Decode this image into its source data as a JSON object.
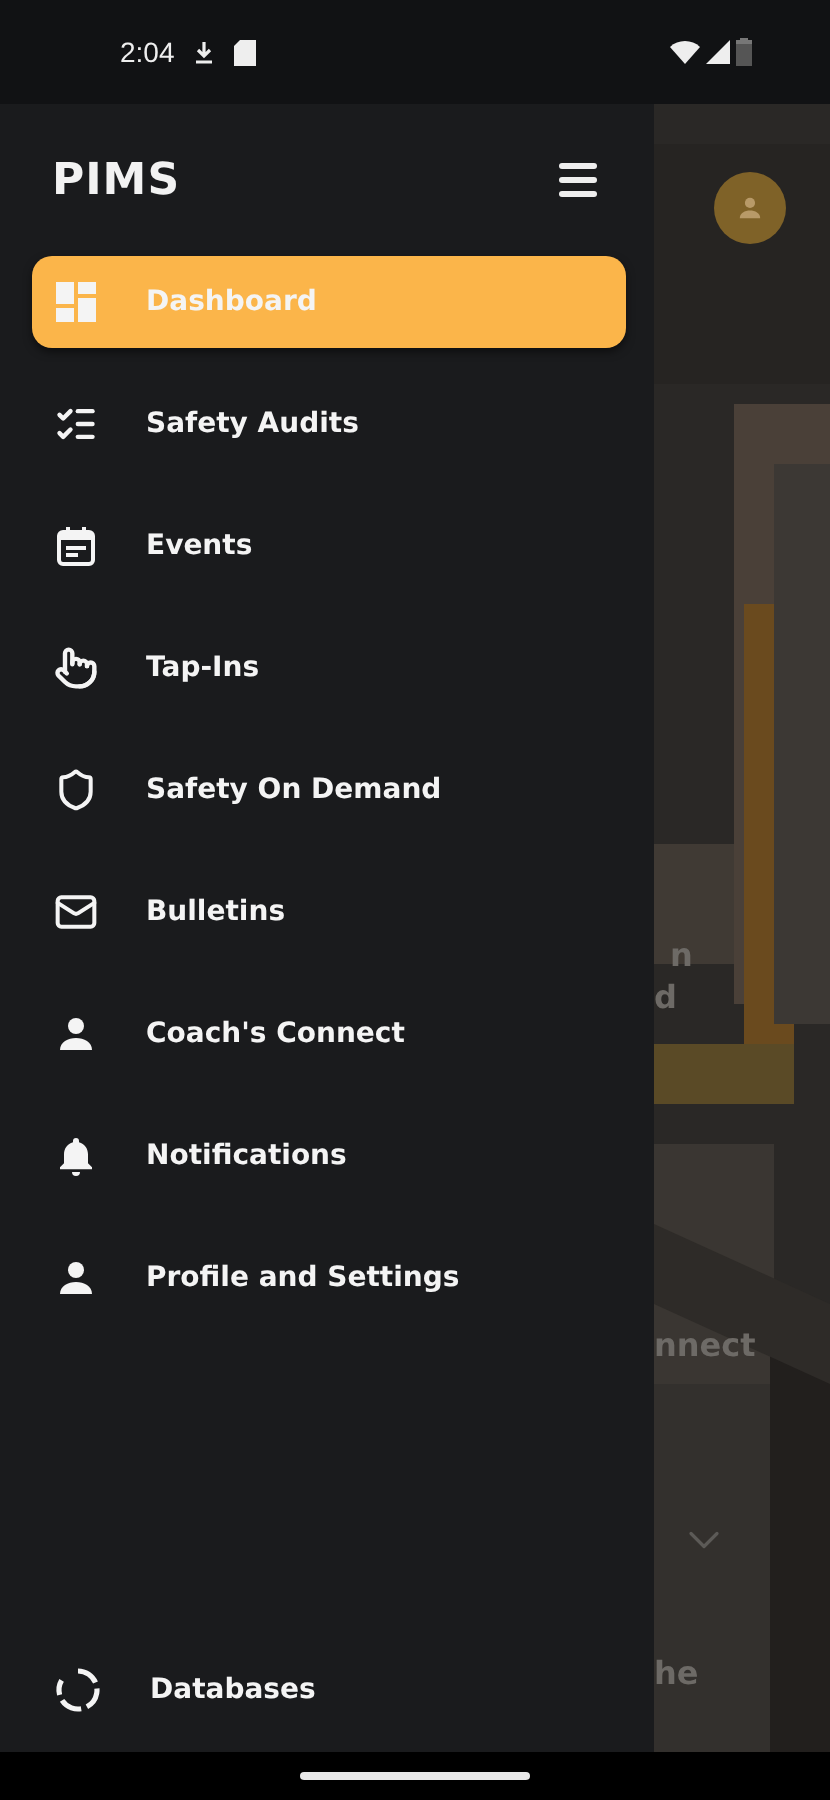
{
  "status_bar": {
    "time": "2:04"
  },
  "drawer": {
    "title": "PIMS",
    "items": [
      {
        "label": "Dashboard",
        "selected": true
      },
      {
        "label": "Safety Audits",
        "selected": false
      },
      {
        "label": "Events",
        "selected": false
      },
      {
        "label": "Tap-Ins",
        "selected": false
      },
      {
        "label": "Safety On Demand",
        "selected": false
      },
      {
        "label": "Bulletins",
        "selected": false
      },
      {
        "label": "Coach's Connect",
        "selected": false
      },
      {
        "label": "Notifications",
        "selected": false
      },
      {
        "label": "Profile and Settings",
        "selected": false
      }
    ],
    "footer_item": {
      "label": "Databases",
      "selected": false
    }
  },
  "background_fragments": [
    "n",
    "d",
    "nnect",
    "he"
  ]
}
